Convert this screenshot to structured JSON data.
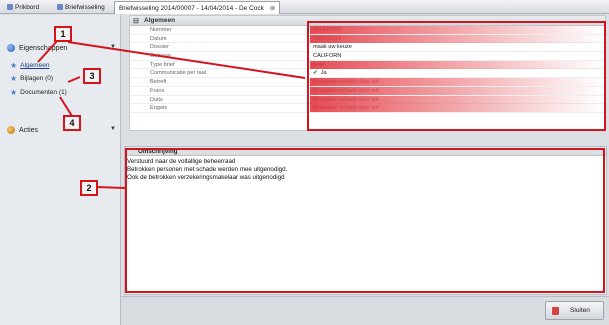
{
  "tabs": [
    {
      "label": "Prikbord"
    },
    {
      "label": "Briefwisseling"
    },
    {
      "label": "Briefwisseling 2014/00007 - 14/04/2014 - De Cock"
    }
  ],
  "sidebar": {
    "section1": "Eigenschappen",
    "items": [
      {
        "label": "Algemeen"
      },
      {
        "label": "Bijlagen (0)"
      },
      {
        "label": "Documenten (1)"
      }
    ],
    "section2": "Acties"
  },
  "grid": {
    "header": "Algemeen",
    "rows": [
      {
        "name": "Nummer",
        "value": "2014/00007"
      },
      {
        "name": "Datum",
        "value": "14/04/2014"
      },
      {
        "name": "Dossier",
        "value": "maak uw keuze"
      },
      {
        "name": "Gebouw",
        "value": "CALIFORN"
      },
      {
        "name": "Type brief",
        "value": "Brief"
      },
      {
        "name": "Communicatie per taal",
        "value": "Ja"
      },
      {
        "name": "Betreft",
        "value": "Bezoeken schade door lek"
      },
      {
        "name": "Frans",
        "value": "Bezoeken schade door lek"
      },
      {
        "name": "Duits",
        "value": "Bezoeken schade door lek"
      },
      {
        "name": "Engels",
        "value": "Bezoeken schade door lek"
      }
    ]
  },
  "description": {
    "header": "Omschrijving",
    "lines": [
      "Verstuurd naar de voltallige beheerraad",
      "Betrokken personen met schade werden mee uitgenodigd.",
      "Ook de betrokken verzekeringsmakelaar was uitgenodigd"
    ]
  },
  "footer": {
    "close_label": "Sluiten"
  },
  "callouts": [
    "1",
    "2",
    "3",
    "4"
  ],
  "colors": {
    "annotation": "#d4141c",
    "link": "#1a3e8a",
    "check": "#2d9a2d"
  }
}
